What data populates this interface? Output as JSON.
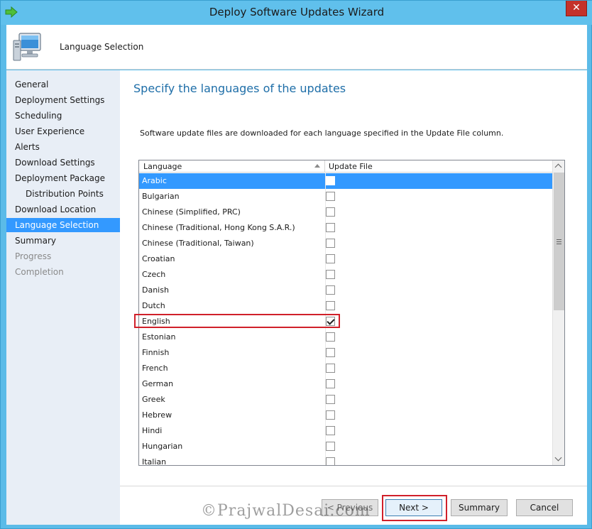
{
  "window": {
    "title": "Deploy Software Updates Wizard",
    "close_glyph": "✕"
  },
  "header": {
    "label": "Language Selection"
  },
  "nav": {
    "items": [
      {
        "label": "General",
        "state": "normal"
      },
      {
        "label": "Deployment Settings",
        "state": "normal"
      },
      {
        "label": "Scheduling",
        "state": "normal"
      },
      {
        "label": "User Experience",
        "state": "normal"
      },
      {
        "label": "Alerts",
        "state": "normal"
      },
      {
        "label": "Download Settings",
        "state": "normal"
      },
      {
        "label": "Deployment Package",
        "state": "normal"
      },
      {
        "label": "Distribution Points",
        "state": "sub"
      },
      {
        "label": "Download Location",
        "state": "normal"
      },
      {
        "label": "Language Selection",
        "state": "active"
      },
      {
        "label": "Summary",
        "state": "normal"
      },
      {
        "label": "Progress",
        "state": "disabled"
      },
      {
        "label": "Completion",
        "state": "disabled"
      }
    ]
  },
  "main": {
    "title": "Specify the languages of the updates",
    "description": "Software update files are downloaded for each language specified in the Update File column."
  },
  "grid": {
    "columns": {
      "language": "Language",
      "update_file": "Update File"
    },
    "rows": [
      {
        "language": "Arabic",
        "checked": false,
        "selected": true
      },
      {
        "language": "Bulgarian",
        "checked": false,
        "selected": false
      },
      {
        "language": "Chinese (Simplified, PRC)",
        "checked": false,
        "selected": false
      },
      {
        "language": "Chinese (Traditional, Hong Kong S.A.R.)",
        "checked": false,
        "selected": false
      },
      {
        "language": "Chinese (Traditional, Taiwan)",
        "checked": false,
        "selected": false
      },
      {
        "language": "Croatian",
        "checked": false,
        "selected": false
      },
      {
        "language": "Czech",
        "checked": false,
        "selected": false
      },
      {
        "language": "Danish",
        "checked": false,
        "selected": false
      },
      {
        "language": "Dutch",
        "checked": false,
        "selected": false
      },
      {
        "language": "English",
        "checked": true,
        "selected": false
      },
      {
        "language": "Estonian",
        "checked": false,
        "selected": false
      },
      {
        "language": "Finnish",
        "checked": false,
        "selected": false
      },
      {
        "language": "French",
        "checked": false,
        "selected": false
      },
      {
        "language": "German",
        "checked": false,
        "selected": false
      },
      {
        "language": "Greek",
        "checked": false,
        "selected": false
      },
      {
        "language": "Hebrew",
        "checked": false,
        "selected": false
      },
      {
        "language": "Hindi",
        "checked": false,
        "selected": false
      },
      {
        "language": "Hungarian",
        "checked": false,
        "selected": false
      },
      {
        "language": "Italian",
        "checked": false,
        "selected": false
      }
    ]
  },
  "buttons": {
    "previous": "< Previous",
    "next": "Next >",
    "summary": "Summary",
    "cancel": "Cancel"
  },
  "watermark": "©PrajwalDesai.com",
  "colors": {
    "accent": "#3399ff",
    "highlight": "#d0202a",
    "title_blue": "#1e6ea8"
  }
}
